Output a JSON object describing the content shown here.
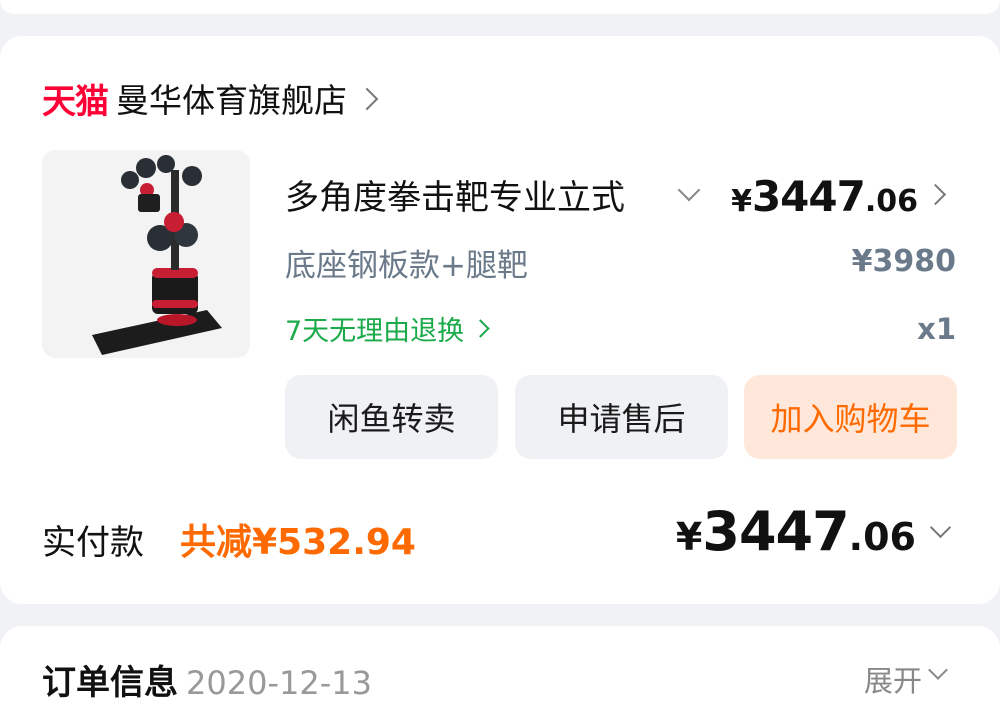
{
  "shop": {
    "platform": "天猫",
    "name": "曼华体育旗舰店",
    "chevron_icon": "chevron-right-icon"
  },
  "product": {
    "title": "多角度拳击靶专业立式",
    "sku": "底座钢板款+腿靶",
    "price": {
      "currency": "¥",
      "integer": "3447",
      "decimal": ".06"
    },
    "original_price": "¥3980",
    "quantity": "x1",
    "refund_policy": "7天无理由退换",
    "image_icon": "boxing-target-image"
  },
  "actions": {
    "resell": "闲鱼转卖",
    "after_sale": "申请售后",
    "add_to_cart": "加入购物车"
  },
  "summary": {
    "paid_label": "实付款",
    "discount": "共减¥532.94",
    "total": {
      "currency": "¥",
      "integer": "3447",
      "decimal": ".06"
    }
  },
  "order_info": {
    "title": "订单信息",
    "date": "2020-12-13",
    "expand": "展开"
  },
  "colors": {
    "tmall": "#ff0036",
    "accent": "#ff6a00",
    "green": "#1aaa4a",
    "muted": "#6b7a8a"
  }
}
